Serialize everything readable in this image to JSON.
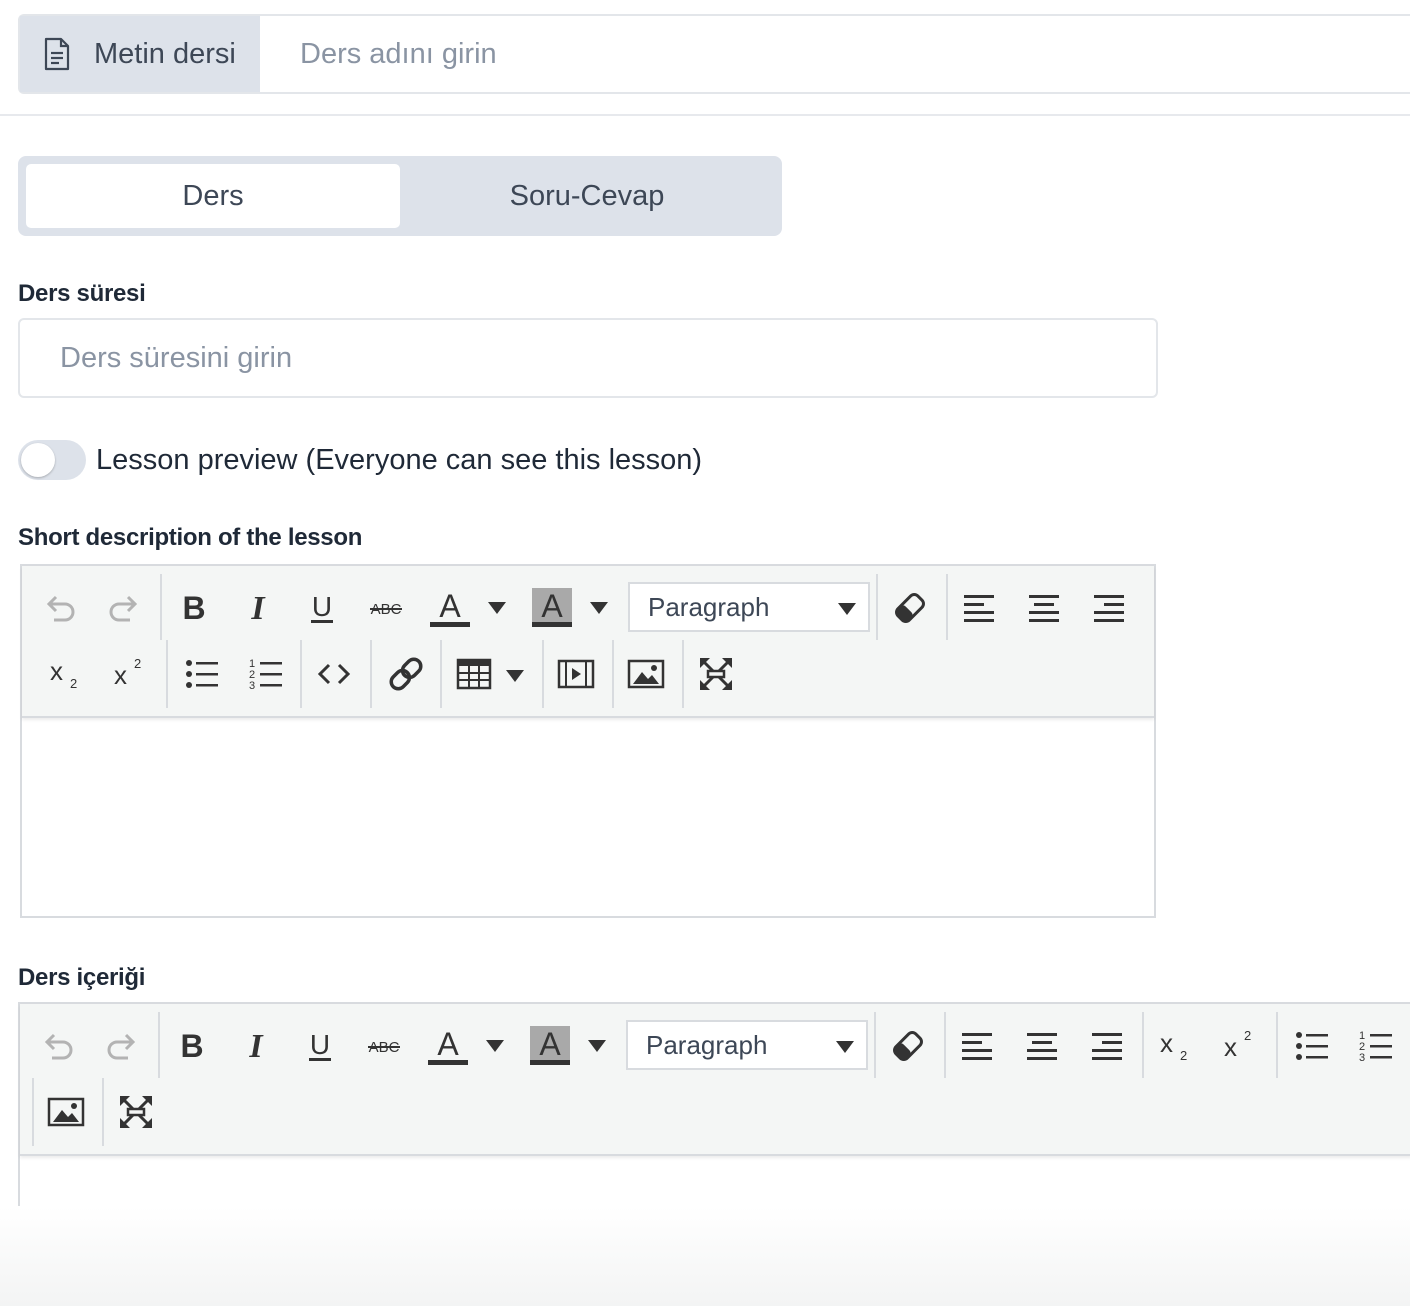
{
  "header": {
    "type_label": "Metin dersi",
    "name_placeholder": "Ders adını girin"
  },
  "tabs": [
    {
      "label": "Ders",
      "active": true
    },
    {
      "label": "Soru-Cevap",
      "active": false
    }
  ],
  "duration": {
    "label": "Ders süresi",
    "placeholder": "Ders süresini girin"
  },
  "preview_toggle": {
    "label": "Lesson preview (Everyone can see this lesson)",
    "on": false
  },
  "short_description": {
    "label": "Short description of the lesson",
    "format_select": "Paragraph"
  },
  "content": {
    "label": "Ders içeriği",
    "format_select": "Paragraph"
  },
  "toolbar_icons": [
    "undo-icon",
    "redo-icon",
    "bold-icon",
    "italic-icon",
    "underline-icon",
    "strikethrough-icon",
    "text-color-icon",
    "background-color-icon",
    "eraser-icon",
    "align-left-icon",
    "align-center-icon",
    "align-right-icon",
    "subscript-icon",
    "superscript-icon",
    "bullet-list-icon",
    "numbered-list-icon",
    "code-view-icon",
    "link-icon",
    "table-icon",
    "video-icon",
    "image-icon",
    "fullscreen-icon"
  ],
  "colors": {
    "chip_bg": "#dde2ea",
    "border": "#e3e6ea",
    "toolbar_bg": "#f4f6f5",
    "icon": "#333333"
  }
}
